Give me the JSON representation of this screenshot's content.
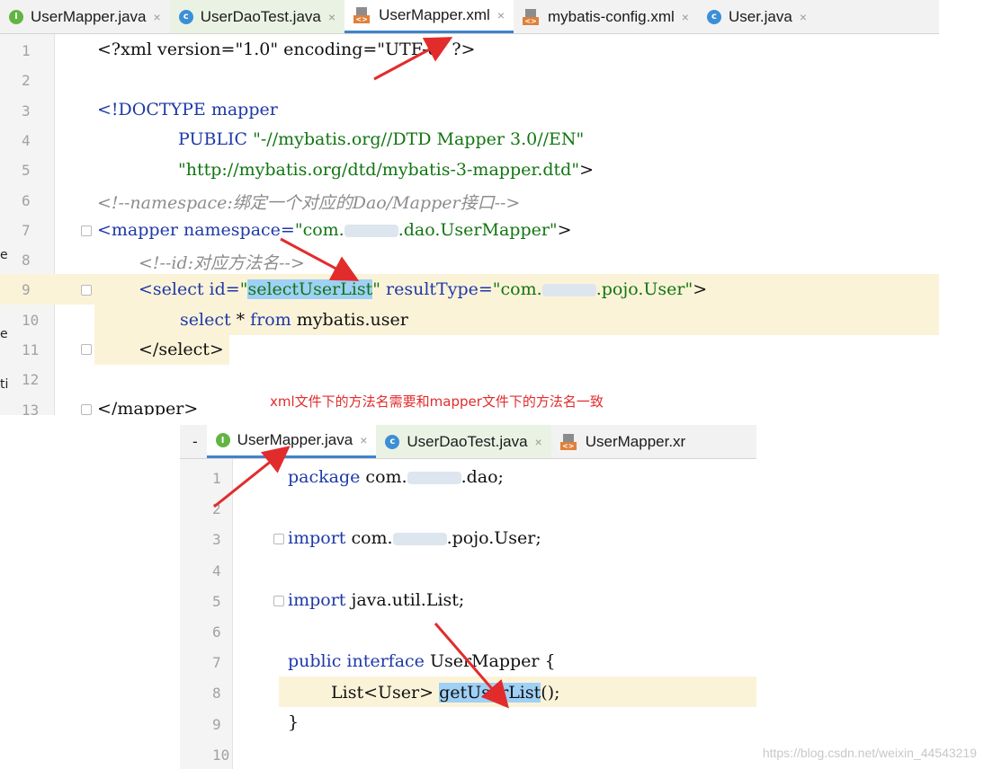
{
  "top_editor": {
    "tabs": [
      {
        "label": "UserMapper.java",
        "icon": "interface-icon"
      },
      {
        "label": "UserDaoTest.java",
        "icon": "class-icon"
      },
      {
        "label": "UserMapper.xml",
        "icon": "xml-icon"
      },
      {
        "label": "mybatis-config.xml",
        "icon": "xml-icon"
      },
      {
        "label": "User.java",
        "icon": "class-icon"
      }
    ],
    "line_numbers": [
      "1",
      "2",
      "3",
      "4",
      "5",
      "6",
      "7",
      "8",
      "9",
      "10",
      "11",
      "12",
      "13"
    ],
    "lines": {
      "l1": "<?xml version=\"1.0\" encoding=\"UTF-8\" ?>",
      "l3a": "<!DOCTYPE",
      "l3b": " mapper",
      "l4a": "PUBLIC",
      "l4b": " \"-//mybatis.org//DTD Mapper 3.0//EN\"",
      "l5a": "\"http://mybatis.org/dtd/mybatis-3-mapper.dtd\"",
      "l5b": ">",
      "l6": "<!--namespace:绑定一个对应的Dao/Mapper接口-->",
      "l7a": "<mapper",
      "l7b": " namespace=",
      "l7c": "\"com.",
      "l7d": ".dao.UserMapper\"",
      "l7e": ">",
      "l8": "<!--id:对应方法名-->",
      "l9a": "<select",
      "l9b": " id=",
      "l9c": "\"",
      "l9d": "selectUserList",
      "l9e": "\"",
      "l9f": " resultType=",
      "l9g": "\"com.",
      "l9h": ".pojo.User\"",
      "l9i": ">",
      "l10a": "select ",
      "l10b": "*",
      "l10c": " from",
      "l10d": " mybatis.user",
      "l11": "</select>",
      "l13": "</mapper>"
    }
  },
  "caption": "xml文件下的方法名需要和mapper文件下的方法名一致",
  "bottom_editor": {
    "tabs": [
      {
        "label": "UserMapper.java",
        "icon": "interface-icon"
      },
      {
        "label": "UserDaoTest.java",
        "icon": "class-icon"
      },
      {
        "label": "UserMapper.xr",
        "icon": "xml-icon"
      }
    ],
    "line_numbers": [
      "1",
      "2",
      "3",
      "4",
      "5",
      "6",
      "7",
      "8",
      "9",
      "10"
    ],
    "lines": {
      "b1a": "package",
      "b1b": " com.",
      "b1c": ".dao;",
      "b3a": "import",
      "b3b": " com.",
      "b3c": ".pojo.User;",
      "b5a": "import",
      "b5b": " java.util.List;",
      "b7a": "public interface",
      "b7b": " UserMapper {",
      "b8a": "List<User> ",
      "b8b": "getUserList",
      "b8c": "();",
      "b9": "}"
    }
  },
  "watermark": "https://blog.csdn.net/weixin_44543219",
  "colors": {
    "keyword": "#1e39a8",
    "string": "#127512",
    "comment": "#8c8c8c",
    "selection": "#9fd0f6",
    "current_line": "#fbf3d8",
    "annotation": "#e22c2c"
  }
}
